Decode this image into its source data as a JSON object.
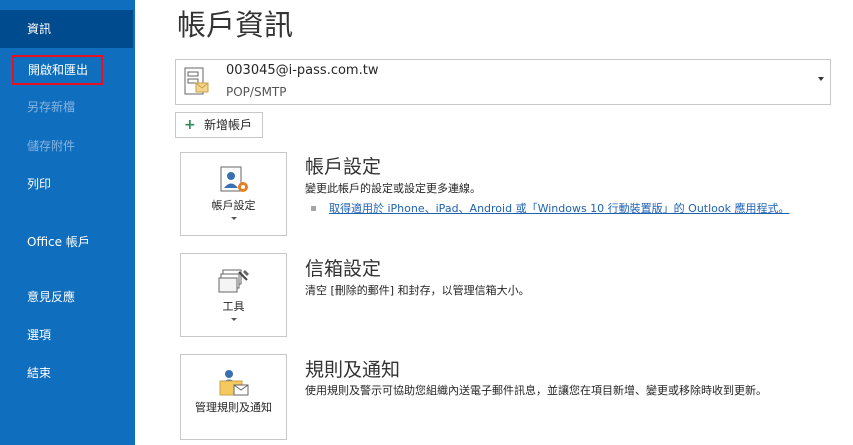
{
  "sidebar": {
    "items": [
      {
        "label": "資訊",
        "state": "active"
      },
      {
        "label": "開啟和匯出",
        "state": "highlighted"
      },
      {
        "label": "另存新檔",
        "state": "disabled"
      },
      {
        "label": "儲存附件",
        "state": "disabled"
      },
      {
        "label": "列印",
        "state": "normal"
      },
      {
        "label": "Office 帳戶",
        "state": "normal"
      },
      {
        "label": "意見反應",
        "state": "normal"
      },
      {
        "label": "選項",
        "state": "normal"
      },
      {
        "label": "結束",
        "state": "normal"
      }
    ]
  },
  "main": {
    "title": "帳戶資訊",
    "account": {
      "email": "003045@i-pass.com.tw",
      "type": "POP/SMTP"
    },
    "add_account_label": "新增帳戶",
    "sections": [
      {
        "tile_label": "帳戶設定",
        "icon": "account-settings-icon",
        "title": "帳戶設定",
        "description": "變更此帳戶的設定或設定更多連線。",
        "link": "取得適用於 iPhone、iPad、Android 或「Windows 10 行動裝置版」的 Outlook 應用程式。"
      },
      {
        "tile_label": "工具",
        "icon": "tools-icon",
        "title": "信箱設定",
        "description": "清空 [刪除的郵件] 和封存，以管理信箱大小。"
      },
      {
        "tile_label": "管理規則及通知",
        "icon": "rules-icon",
        "title": "規則及通知",
        "description": "使用規則及警示可協助您組織內送電子郵件訊息，並讓您在項目新增、變更或移除時收到更新。"
      }
    ]
  },
  "colors": {
    "sidebar": "#106ebe",
    "sidebar_active": "#004b8d",
    "highlight_border": "#e81123",
    "link": "#1e62b4"
  }
}
